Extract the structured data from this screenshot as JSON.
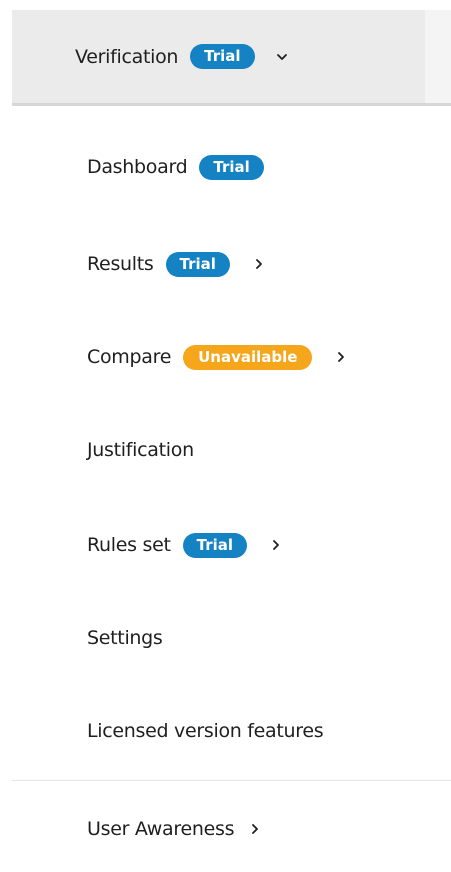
{
  "header": {
    "label": "Verification",
    "badge": "Trial",
    "expand_icon": "chevron-down-icon"
  },
  "items": [
    {
      "label": "Dashboard",
      "badge": "Trial",
      "badge_type": "trial"
    },
    {
      "label": "Results",
      "badge": "Trial",
      "badge_type": "trial",
      "submenu": true
    },
    {
      "label": "Compare",
      "badge": "Unavailable",
      "badge_type": "unavailable",
      "submenu": true
    },
    {
      "label": "Justification"
    },
    {
      "label": "Rules set",
      "badge": "Trial",
      "badge_type": "trial",
      "submenu": true
    },
    {
      "label": "Settings"
    },
    {
      "label": "Licensed version features"
    }
  ],
  "footer_item": {
    "label": "User Awareness",
    "submenu": true
  },
  "colors": {
    "trial_badge": "#1482c3",
    "unavailable_badge": "#f5a61a",
    "header_bg": "#ebebeb"
  }
}
